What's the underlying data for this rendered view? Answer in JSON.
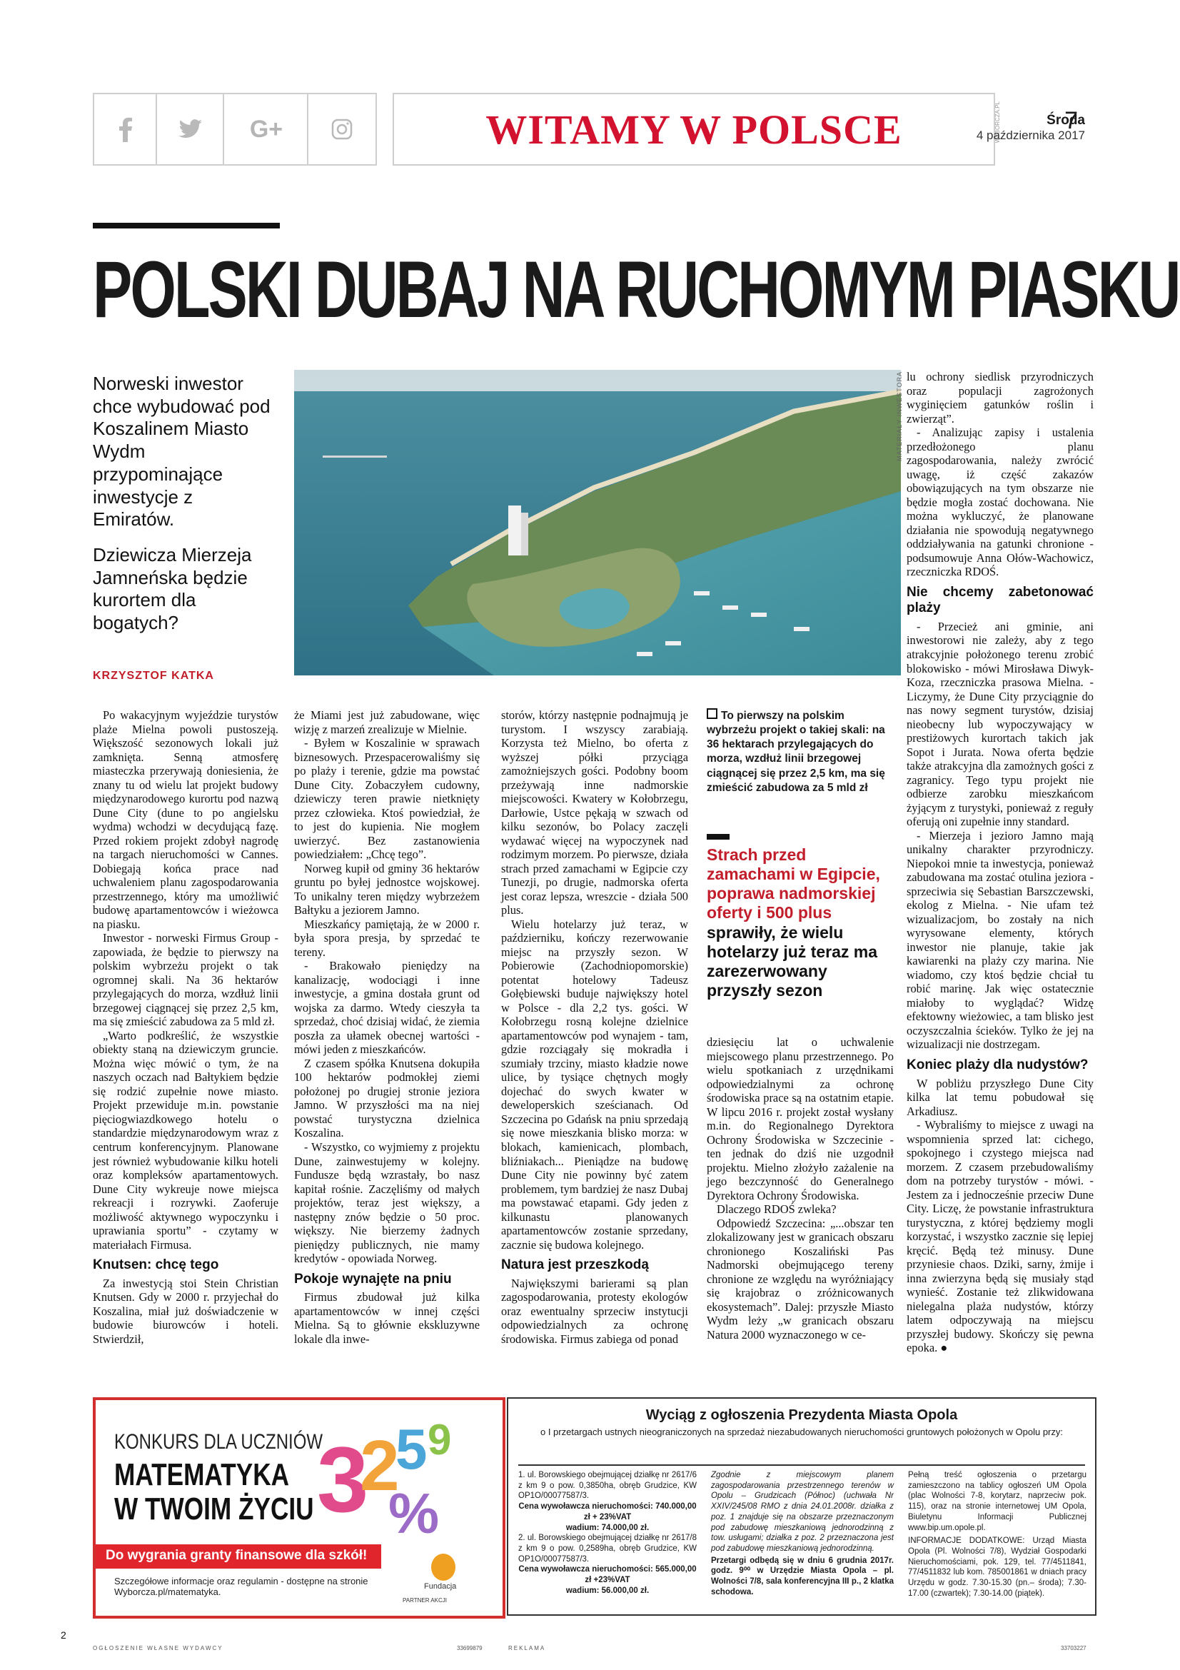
{
  "header": {
    "social": [
      "f",
      "t",
      "G+",
      "ig"
    ],
    "brand": "WITAMY W POLSCE",
    "brand_vertical": "WYBORCZA.PL",
    "day": "Środa",
    "date": "4 października 2017",
    "page_number": "7"
  },
  "article": {
    "headline": "POLSKI DUBAJ NA RUCHOMYM PIASKU",
    "lead1": "Norweski inwestor chce wybudować pod Koszalinem Miasto Wydm przypominające inwestycje z Emiratów.",
    "lead2": "Dziewicza Mierzeja Jamneńska będzie kurortem dla bogatych?",
    "author": "KRZYSZTOF KATKA",
    "photo_credit": "MATERIAŁY INWESTORA",
    "col1": [
      "Po wakacyjnym wyjeździe turystów plaże Mielna powoli pustoszeją. Większość sezonowych lokali już zamknięta. Senną atmosferę miasteczka przerywają doniesienia, że znany tu od wielu lat projekt budowy międzynarodowego kurortu pod nazwą Dune City (dune to po angielsku wydma) wchodzi w decydującą fazę. Przed rokiem projekt zdobył nagrodę na targach nieruchomości w Cannes. Dobiegają końca prace nad uchwaleniem planu zagospodarowania przestrzennego, który ma umożliwić budowę apartamentowców i wieżowca na piasku.",
      "Inwestor - norweski Firmus Group - zapowiada, że będzie to pierwszy na polskim wybrzeżu projekt o tak ogromnej skali. Na 36 hektarów przylegających do morza, wzdłuż linii brzegowej ciągnącej się przez 2,5 km, ma się zmieścić zabudowa za 5 mld zł.",
      "„Warto podkreślić, że wszystkie obiekty staną na dziewiczym gruncie. Można więc mówić o tym, że na naszych oczach nad Bałtykiem będzie się rodzić zupełnie nowe miasto. Projekt przewiduje m.in. powstanie pięciogwiazdkowego hotelu o standardzie międzynarodowym wraz z centrum konferencyjnym. Planowane jest również wybudowanie kilku hoteli oraz kompleksów apartamentowych. Dune City wykreuje nowe miejsca rekreacji i rozrywki. Zaoferuje możliwość aktywnego wypoczynku i uprawiania sportu” - czytamy w materiałach Firmusa."
    ],
    "col1_h": "Knutsen: chcę tego",
    "col1_tail": "Za inwestycją stoi Stein Christian Knutsen. Gdy w 2000 r. przyjechał do Koszalina, miał już doświadczenie w budowie biurowców i hoteli. Stwierdził,",
    "col2": [
      "że Miami jest już zabudowane, więc wizję z marzeń zrealizuje w Mielnie.",
      "- Byłem w Koszalinie w sprawach biznesowych. Przespacerowaliśmy się po plaży i terenie, gdzie ma powstać Dune City. Zobaczyłem cudowny, dziewiczy teren prawie nietknięty przez człowieka. Ktoś powiedział, że to jest do kupienia. Nie mogłem uwierzyć. Bez zastanowienia powiedziałem: „Chcę tego”.",
      "Norweg kupił od gminy 36 hektarów gruntu po byłej jednostce wojskowej. To unikalny teren między wybrzeżem Bałtyku a jeziorem Jamno.",
      "Mieszkańcy pamiętają, że w 2000 r. była spora presja, by sprzedać te tereny.",
      "- Brakowało pieniędzy na kanalizację, wodociągi i inne inwestycje, a gmina dostała grunt od wojska za darmo. Wtedy cieszyła ta sprzedaż, choć dzisiaj widać, że ziemia poszła za ułamek obecnej wartości - mówi jeden z mieszkańców.",
      "Z czasem spółka Knutsena dokupiła 100 hektarów podmokłej ziemi położonej po drugiej stronie jeziora Jamno. W przyszłości ma na niej powstać turystyczna dzielnica Koszalina.",
      "- Wszystko, co wyjmiemy z projektu Dune, zainwestujemy w kolejny. Fundusze będą wzrastały, bo nasz kapitał rośnie. Zaczęliśmy od małych projektów, teraz jest większy, a następny znów będzie o 50 proc. większy. Nie bierzemy żadnych pieniędzy publicznych, nie mamy kredytów - opowiada Norweg."
    ],
    "col2_h": "Pokoje wynajęte na pniu",
    "col2_tail": "Firmus zbudował już kilka apartamentowców w innej części Mielna. Są to głównie ekskluzywne lokale dla inwe-",
    "col3": [
      "storów, którzy następnie podnajmują je turystom. I wszyscy zarabiają. Korzysta też Mielno, bo oferta z wyższej półki przyciąga zamożniejszych gości. Podobny boom przeżywają inne nadmorskie miejscowości. Kwatery w Kołobrzegu, Darłowie, Ustce pękają w szwach od kilku sezonów, bo Polacy zaczęli wydawać więcej na wypoczynek nad rodzimym morzem. Po pierwsze, działa strach przed zamachami w Egipcie czy Tunezji, po drugie, nadmorska oferta jest coraz lepsza, wreszcie - działa 500 plus.",
      "Wielu hotelarzy już teraz, w październiku, kończy rezerwowanie miejsc na przyszły sezon. W Pobierowie (Zachodniopomorskie) potentat hotelowy Tadeusz Gołębiewski buduje największy hotel w Polsce - dla 2,2 tys. gości. W Kołobrzegu rosną kolejne dzielnice apartamentowców pod wynajem - tam, gdzie rozciągały się mokradła i szumiały trzciny, miasto kładzie nowe ulice, by tysiące chętnych mogły dojechać do swych kwater w deweloperskich sześcianach. Od Szczecina po Gdańsk na pniu sprzedają się nowe mieszkania blisko morza: w blokach, kamienicach, plombach, bliźniakach... Pieniądze na budowę Dune City nie powinny być zatem problemem, tym bardziej że nasz Dubaj ma powstawać etapami. Gdy jeden z kilkunastu planowanych apartamentowców zostanie sprzedany, zacznie się budowa kolejnego."
    ],
    "col3_h": "Natura jest przeszkodą",
    "col3_tail": "Największymi barierami są plan zagospodarowania, protesty ekologów oraz ewentualny sprzeciw instytucji odpowiedzialnych za ochronę środowiska. Firmus zabiega od ponad",
    "box": "To pierwszy na polskim wybrzeżu projekt o takiej skali: na 36 hektarach przylegających do morza, wzdłuż linii brzegowej ciągnącej się przez 2,5 km, ma się zmieścić zabudowa za 5 mld zł",
    "pull_red": "Strach przed zamachami w Egipcie, poprawa nadmorskiej oferty i 500 plus",
    "pull_black": "sprawiły, że wielu hotelarzy już teraz ma zarezerwowany przyszły sezon",
    "col4": [
      "dziesięciu lat o uchwalenie miejscowego planu przestrzennego. Po wielu spotkaniach z urzędnikami odpowiedzialnymi za ochronę środowiska prace są na ostatnim etapie. W lipcu 2016 r. projekt został wysłany m.in. do Regionalnego Dyrektora Ochrony Środowiska w Szczecinie - ten jednak do dziś nie uzgodnił projektu. Mielno złożyło zażalenie na jego bezczynność do Generalnego Dyrektora Ochrony Środowiska.",
      "Dlaczego RDOŚ zwleka?",
      "Odpowiedź Szczecina: „...obszar ten zlokalizowany jest w granicach obszaru chronionego Koszaliński Pas Nadmorski obejmującego tereny chronione ze względu na wyróżniający się krajobraz o zróżnicowanych ekosystemach”. Dalej: przyszłe Miasto Wydm leży „w granicach obszaru Natura 2000 wyznaczonego w ce-"
    ],
    "col5": [
      "lu ochrony siedlisk przyrodniczych oraz populacji zagrożonych wyginięciem gatunków roślin i zwierząt”.",
      "- Analizując zapisy i ustalenia przedłożonego planu zagospodarowania, należy zwrócić uwagę, iż część zakazów obowiązujących na tym obszarze nie będzie mogła zostać dochowana. Nie można wykluczyć, że planowane działania nie spowodują negatywnego oddziaływania na gatunki chronione - podsumowuje Anna Ołów-Wachowicz, rzeczniczka RDOŚ."
    ],
    "col5_h1": "Nie chcemy zabetonować plaży",
    "col5_b": [
      "- Przecież ani gminie, ani inwestorowi nie zależy, aby z tego atrakcyjnie położonego terenu zrobić blokowisko - mówi Mirosława Diwyk-Koza, rzeczniczka prasowa Mielna. - Liczymy, że Dune City przyciągnie do nas nowy segment turystów, dzisiaj nieobecny lub wypoczywający w prestiżowych kurortach takich jak Sopot i Jurata. Nowa oferta będzie także atrakcyjna dla zamożnych gości z zagranicy. Tego typu projekt nie odbierze zarobku mieszkańcom żyjącym z turystyki, ponieważ z reguły oferują oni zupełnie inny standard.",
      "- Mierzeja i jezioro Jamno mają unikalny charakter przyrodniczy. Niepokoi mnie ta inwestycja, ponieważ zabudowana ma zostać otulina jeziora - sprzeciwia się Sebastian Barszczewski, ekolog z Mielna. - Nie ufam też wizualizacjom, bo zostały na nich wyrysowane elementy, których inwestor nie planuje, takie jak kawiarenki na plaży czy marina. Nie wiadomo, czy ktoś będzie chciał tu robić marinę. Jak więc ostatecznie miałoby to wyglądać? Widzę efektowny wieżowiec, a tam blisko jest oczyszczalnia ścieków. Tylko że jej na wizualizacji nie dostrzegam."
    ],
    "col5_h2": "Koniec plaży dla nudystów?",
    "col5_c": [
      "W pobliżu przyszłego Dune City kilka lat temu pobudował się Arkadiusz.",
      "- Wybraliśmy to miejsce z uwagi na wspomnienia sprzed lat: cichego, spokojnego i czystego miejsca nad morzem. Z czasem przebudowaliśmy dom na potrzeby turystów - mówi. - Jestem za i jednocześnie przeciw Dune City. Liczę, że powstanie infrastruktura turystyczna, z której będziemy mogli korzystać, i wszystko zacznie się lepiej kręcić. Będą też minusy. Dune przyniesie chaos. Dziki, sarny, żmije i inna zwierzyna będą się musiały stąd wynieść. Zostanie też zlikwidowana nielegalna plaża nudystów, którzy latem odpoczywają na miejscu przyszłej budowy. Skończy się pewna epoka. ●"
    ]
  },
  "ad_left": {
    "line1": "KONKURS DLA UCZNIÓW",
    "line2": "MATEMATYKA",
    "line3": "W TWOIM ŻYCIU",
    "banner": "Do wygrania granty finansowe dla szkół!",
    "info": "Szczegółowe informacje oraz regulamin - dostępne na stronie Wyborcza.pl/matematyka.",
    "partner": "PARTNER AKCJI",
    "fund": "Fundacja"
  },
  "ad_right": {
    "title": "Wyciąg z ogłoszenia Prezydenta Miasta Opola",
    "subtitle": "o I przetargach ustnych nieograniczonych na sprzedaż niezabudowanych nieruchomości gruntowych położonych w Opolu przy:",
    "c1": [
      "1. ul. Borowskiego obejmującej działkę nr 2617/6 z km 9 o pow. 0,3850ha, obręb Grudzice, KW OP1O/00077587/3.",
      "Cena wywoławcza nieruchomości: 740.000,00 zł + 23%VAT",
      "wadium: 74.000,00 zł.",
      "2. ul. Borowskiego obejmującej działkę nr 2617/8 z km 9 o pow. 0,2589ha, obręb Grudzice, KW OP1O/00077587/3.",
      "Cena wywoławcza nieruchomości: 565.000,00 zł +23%VAT",
      "wadium: 56.000,00 zł."
    ],
    "c2": "Zgodnie z miejscowym planem zagospodarowania przestrzennego terenów w Opolu – Grudzicach (Północ) (uchwała Nr XXIV/245/08 RMO z dnia 24.01.2008r. działka z poz. 1 znajduje się na obszarze przeznaczonym pod zabudowę mieszkaniową jednorodzinną z tow. usługami; działka z poz. 2 przeznaczona jest pod zabudowę mieszkaniową jednorodzinną.",
    "c2b": "Przetargi odbędą się w dniu 6 grudnia 2017r. godz. 9⁰⁰ w Urzędzie Miasta Opola – pl. Wolności 7/8, sala konferencyjna III p., 2 klatka schodowa.",
    "c3": "Pełną treść ogłoszenia o przetargu zamieszczono na tablicy ogłoszeń UM Opola (plac Wolności 7-8, korytarz, naprzeciw pok. 115), oraz na stronie internetowej UM Opola, Biuletynu Informacji Publicznej www.bip.um.opole.pl.",
    "c3b": "INFORMACJE DODATKOWE: Urząd Miasta Opola (Pl. Wolności 7/8), Wydział Gospodarki Nieruchomościami, pok. 129, tel. 77/4511841, 77/4511832 lub kom. 785001861 w dniach pracy Urzędu w godz. 7.30-15.30 (pn.– środa); 7.30-17.00 (czwartek); 7.30-14.00 (piątek)."
  },
  "footer": {
    "left_num": "2",
    "left_label": "OGŁOSZENIE WŁASNE WYDAWCY",
    "code1": "33699879",
    "right_label": "REKLAMA",
    "code2": "33703227"
  }
}
